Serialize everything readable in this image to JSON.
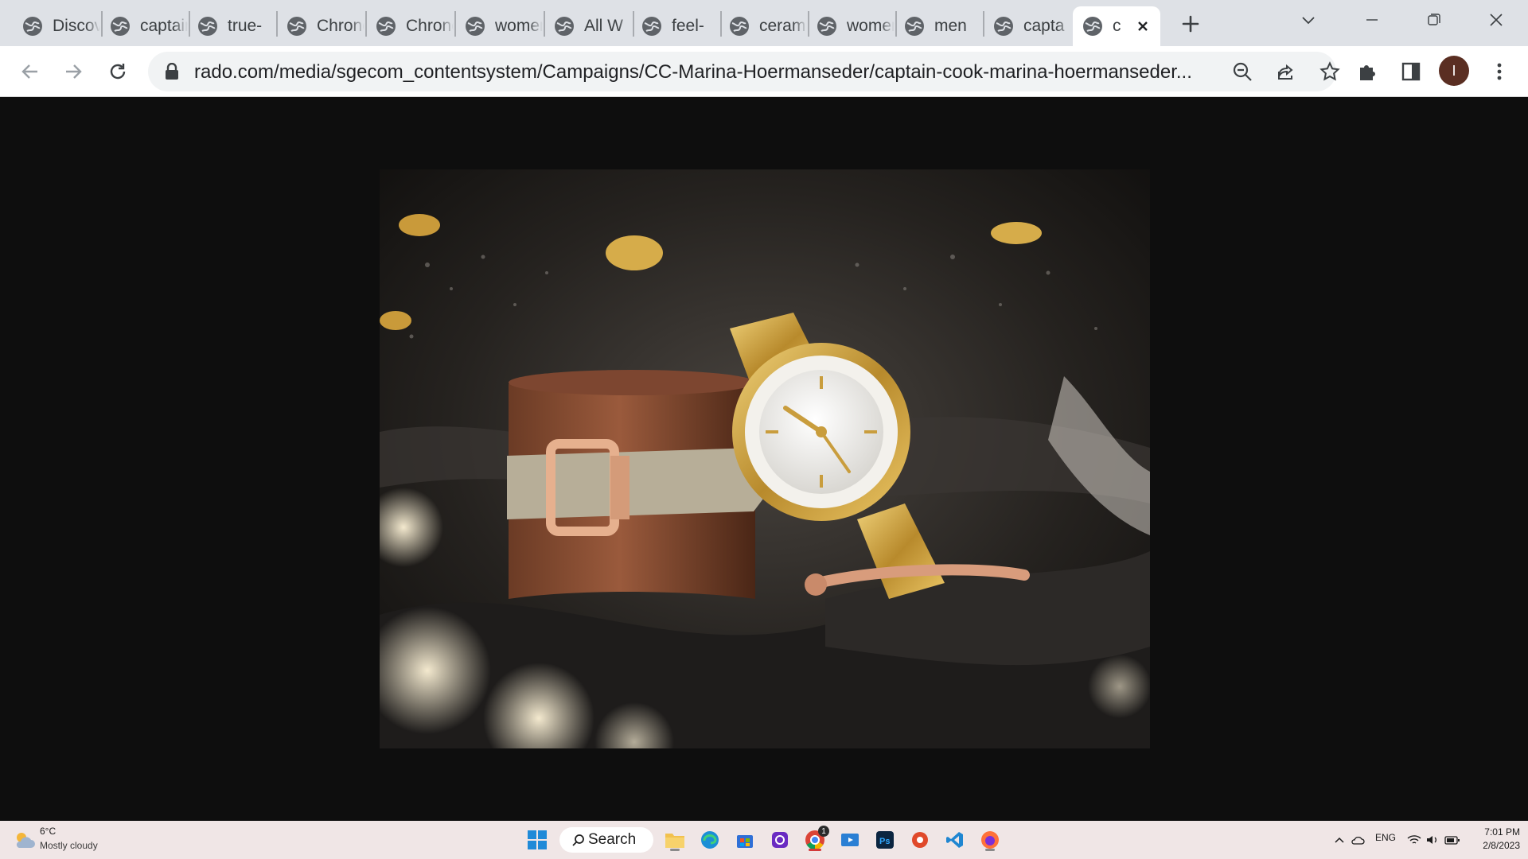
{
  "browser": {
    "tabs": [
      {
        "title": "Discover"
      },
      {
        "title": "captain"
      },
      {
        "title": "true-"
      },
      {
        "title": "Chrono"
      },
      {
        "title": "Chrono"
      },
      {
        "title": "women"
      },
      {
        "title": "All W"
      },
      {
        "title": "feel-"
      },
      {
        "title": "ceram"
      },
      {
        "title": "women"
      },
      {
        "title": "men"
      },
      {
        "title": "capta"
      },
      {
        "title": "c",
        "active": true
      }
    ],
    "url": "rado.com/media/sgecom_contentsystem/Campaigns/CC-Marina-Hoermanseder/captain-cook-marina-hoermanseder...",
    "profile_initial": "I"
  },
  "taskbar": {
    "weather_temp": "6°C",
    "weather_condition": "Mostly cloudy",
    "search_label": "Search",
    "language": "ENG",
    "time": "7:01 PM",
    "date": "2/8/2023",
    "chrome_badge": "1"
  },
  "colors": {
    "tabstrip": "#dee1e6",
    "toolbar": "#ffffff",
    "viewport": "#0e0e0e",
    "taskbar": "#f0e6e6",
    "avatar": "#5a2e22"
  }
}
